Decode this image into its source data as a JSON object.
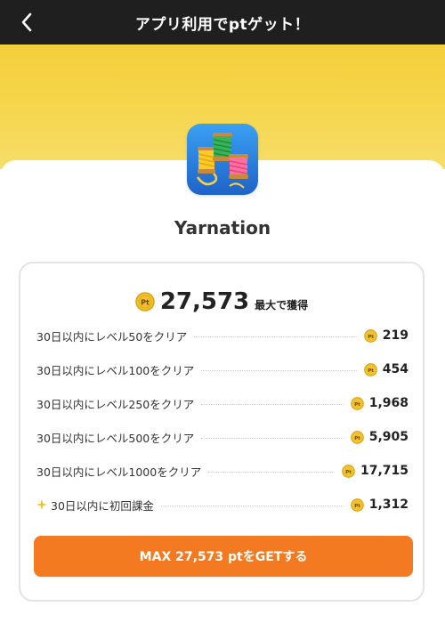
{
  "header": {
    "title": "アプリ利用でptゲット！",
    "back_icon": "chevron-left-icon"
  },
  "app": {
    "name": "Yarnation",
    "icon": "yarn-spools-app-icon"
  },
  "reward": {
    "total": "27,573",
    "total_suffix": "最大で獲得",
    "coin_icon": "pt-coin-icon",
    "tasks": [
      {
        "label": "30日以内にレベル50をクリア",
        "points": "219"
      },
      {
        "label": "30日以内にレベル100をクリア",
        "points": "454"
      },
      {
        "label": "30日以内にレベル250をクリア",
        "points": "1,968"
      },
      {
        "label": "30日以内にレベル500をクリア",
        "points": "5,905"
      },
      {
        "label": "30日以内にレベル1000をクリア",
        "points": "17,715"
      },
      {
        "label": "30日以内に初回課金",
        "points": "1,312",
        "icon": "sparkle-icon"
      }
    ],
    "cta_label": "MAX 27,573 ptをGETする"
  },
  "colors": {
    "header_bg": "#1f1f1f",
    "hero_yellow": "#f3cf3a",
    "cta_orange": "#f47a22",
    "coin_gold": "#f2c12e"
  }
}
